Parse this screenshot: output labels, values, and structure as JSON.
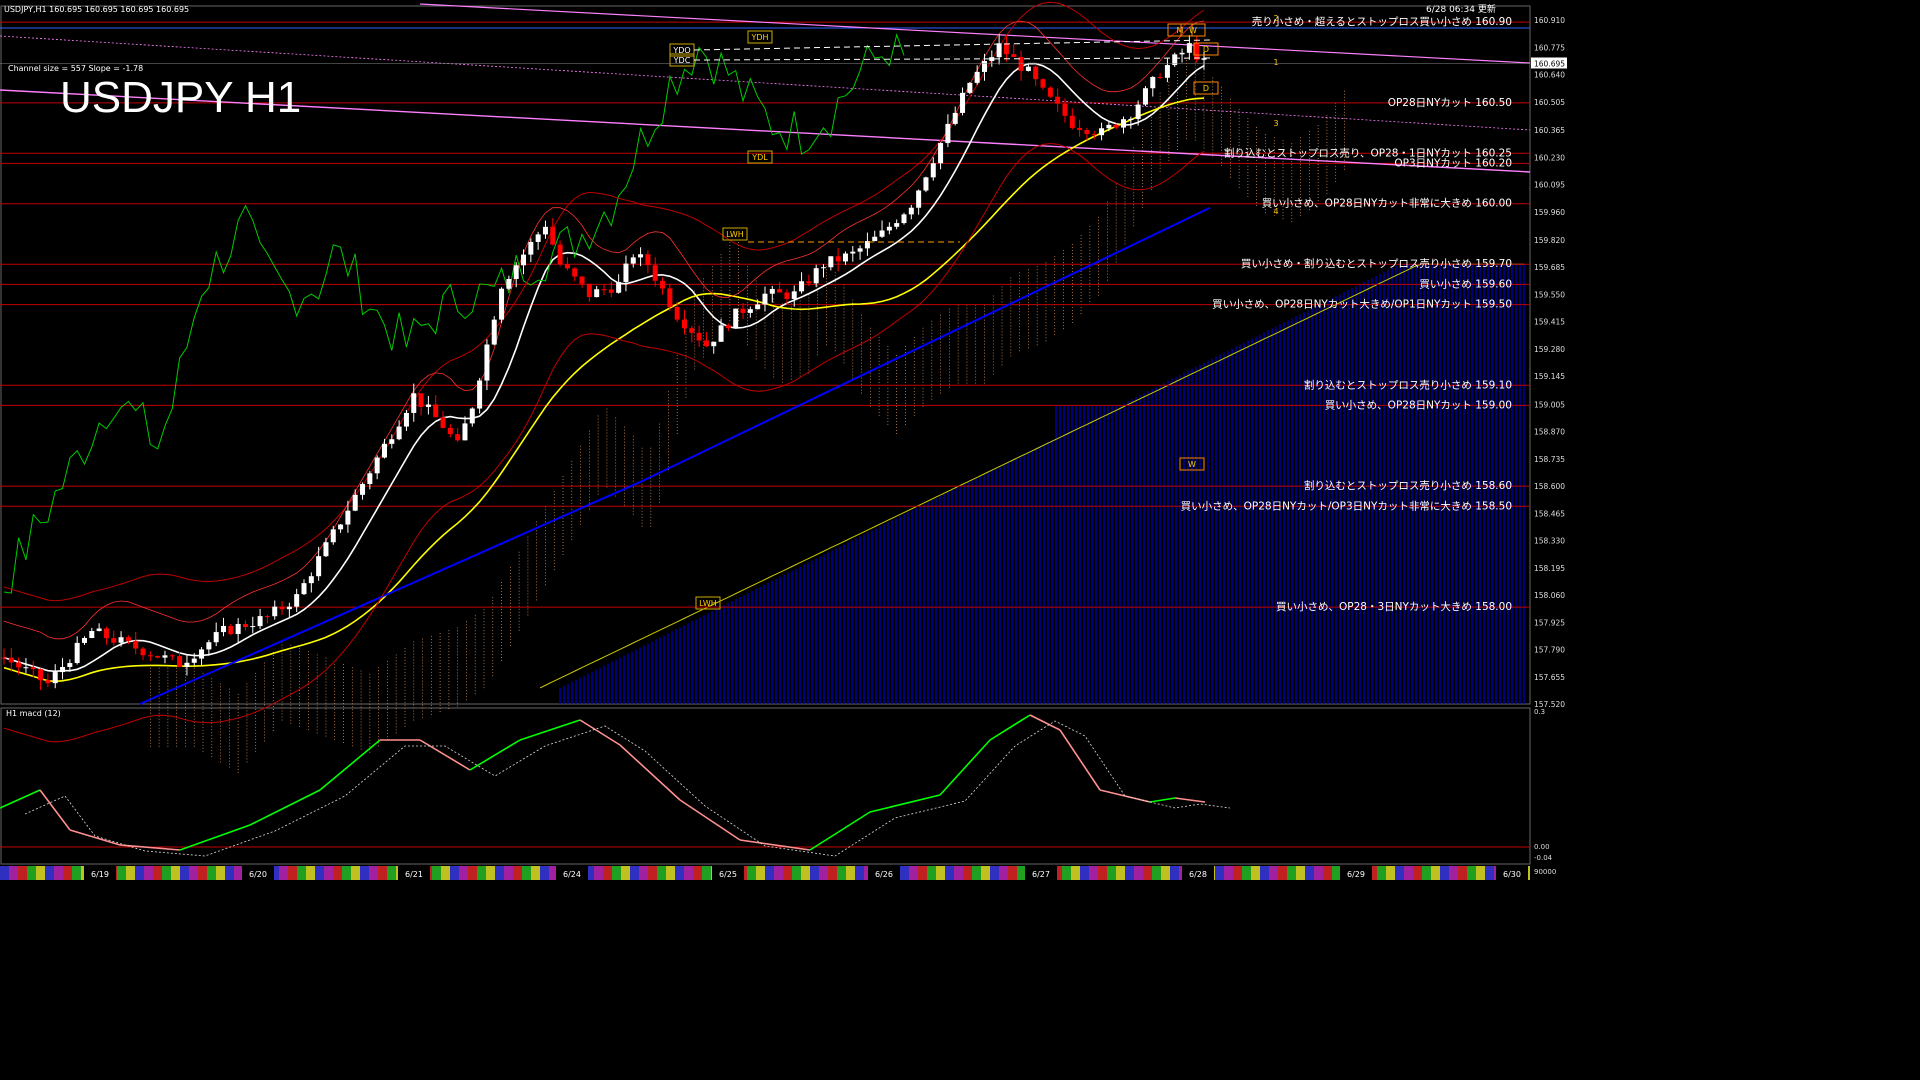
{
  "header": {
    "symbol_line": "USDJPY,H1  160.695 160.695 160.695 160.695",
    "updated": "6/28 06:34 更新",
    "channel_info": "Channel size = 557 Slope = -1.78",
    "big_title": "USDJPY H1"
  },
  "macd_panel": {
    "label": "H1  macd (12)",
    "ticks": [
      "0.3",
      "0.00",
      "-0.04",
      "90000"
    ]
  },
  "current_price": "160.695",
  "dates": [
    "6/19",
    "6/20",
    "6/21",
    "6/24",
    "6/25",
    "6/26",
    "6/27",
    "6/28",
    "6/29",
    "6/30"
  ],
  "chart_markers": [
    "YDH",
    "YDO",
    "YDC",
    "YDL",
    "LWH",
    "LWH",
    "W",
    "M",
    "W",
    "D",
    "D",
    "1",
    "2",
    "3",
    "4"
  ],
  "colors": {
    "background": "#000000",
    "bull_candle": "#ffffff",
    "bear_candle": "#ff0000",
    "level_line": "#c00000",
    "ma_fast": "#ffffff",
    "ma_mid": "#ffff00",
    "ma_slow": "#0000ff",
    "chikou": "#00cc00",
    "channel": "#ff80ff",
    "cloud": "#f0a060",
    "cloud_blue": "#0000cc",
    "macd_up": "#00ff00",
    "macd_down": "#ff9090"
  },
  "chart_data": {
    "type": "line",
    "ylim": [
      157.52,
      160.98
    ],
    "y_ticks": [
      "160.910",
      "160.775",
      "160.640",
      "160.505",
      "160.365",
      "160.230",
      "160.095",
      "159.960",
      "159.820",
      "159.685",
      "159.550",
      "159.415",
      "159.280",
      "159.145",
      "159.005",
      "158.870",
      "158.735",
      "158.600",
      "158.465",
      "158.330",
      "158.195",
      "158.060",
      "157.925",
      "157.790",
      "157.655",
      "157.520"
    ],
    "levels": [
      {
        "price": 160.9,
        "label": "売り小さめ・超えるとストップロス買い小さめ 160.90"
      },
      {
        "price": 160.5,
        "label": "OP28日NYカット 160.50"
      },
      {
        "price": 160.25,
        "label": "割り込むとストップロス売り、OP28・1日NYカット 160.25"
      },
      {
        "price": 160.2,
        "label": "OP3日NYカット 160.20"
      },
      {
        "price": 160.0,
        "label": "買い小さめ、OP28日NYカット非常に大きめ 160.00"
      },
      {
        "price": 159.7,
        "label": "買い小さめ・割り込むとストップロス売り小さめ 159.70"
      },
      {
        "price": 159.6,
        "label": "買い小さめ 159.60"
      },
      {
        "price": 159.5,
        "label": "買い小さめ、OP28日NYカット大きめ/OP1日NYカット 159.50"
      },
      {
        "price": 159.1,
        "label": "割り込むとストップロス売り小さめ 159.10"
      },
      {
        "price": 159.0,
        "label": "買い小さめ、OP28日NYカット 159.00"
      },
      {
        "price": 158.6,
        "label": "割り込むとストップロス売り小さめ 158.60"
      },
      {
        "price": 158.5,
        "label": "買い小さめ、OP28日NYカット/OP3日NYカット非常に大きめ 158.50"
      },
      {
        "price": 158.0,
        "label": "買い小さめ、OP28・3日NYカット大きめ 158.00"
      }
    ],
    "price_path": [
      [
        0,
        157.75
      ],
      [
        6,
        157.62
      ],
      [
        12,
        157.88
      ],
      [
        18,
        157.8
      ],
      [
        24,
        157.72
      ],
      [
        30,
        157.88
      ],
      [
        36,
        157.95
      ],
      [
        40,
        158.05
      ],
      [
        44,
        158.3
      ],
      [
        48,
        158.55
      ],
      [
        52,
        158.8
      ],
      [
        56,
        159.05
      ],
      [
        60,
        158.9
      ],
      [
        62,
        158.8
      ],
      [
        64,
        159.0
      ],
      [
        66,
        159.3
      ],
      [
        68,
        159.6
      ],
      [
        72,
        159.8
      ],
      [
        74,
        159.9
      ],
      [
        76,
        159.7
      ],
      [
        80,
        159.55
      ],
      [
        84,
        159.6
      ],
      [
        86,
        159.75
      ],
      [
        88,
        159.7
      ],
      [
        92,
        159.45
      ],
      [
        96,
        159.3
      ],
      [
        100,
        159.45
      ],
      [
        104,
        159.55
      ],
      [
        108,
        159.55
      ],
      [
        112,
        159.7
      ],
      [
        116,
        159.75
      ],
      [
        120,
        159.85
      ],
      [
        124,
        160.0
      ],
      [
        128,
        160.3
      ],
      [
        132,
        160.6
      ],
      [
        136,
        160.78
      ],
      [
        140,
        160.65
      ],
      [
        142,
        160.55
      ],
      [
        146,
        160.4
      ],
      [
        150,
        160.35
      ],
      [
        154,
        160.45
      ],
      [
        158,
        160.65
      ],
      [
        162,
        160.78
      ],
      [
        164,
        160.695
      ]
    ]
  }
}
